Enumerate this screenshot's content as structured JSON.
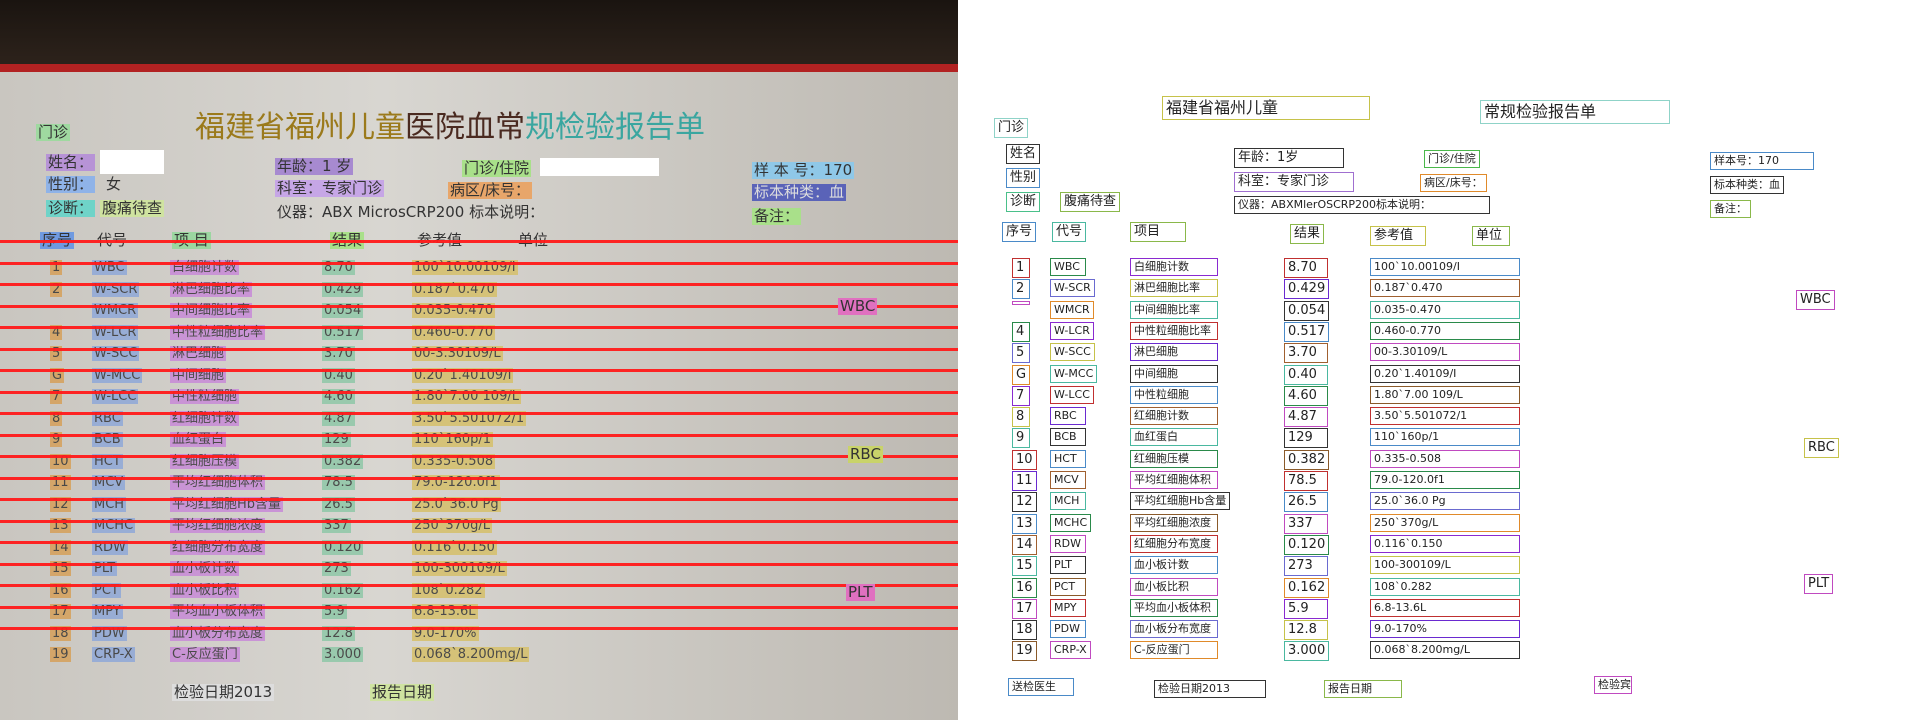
{
  "header": {
    "hospital": "福建省福州儿童",
    "report_title": "常规检验报告单",
    "ward_type": "门诊"
  },
  "patient": {
    "name_label": "姓名",
    "gender_label": "性别",
    "gender_value": "女",
    "diagnosis_label": "诊断",
    "diagnosis_value": "腹痛待查",
    "age": "年龄：1岁",
    "department": "科室：专家门诊",
    "instrument": "仪器：ABXMlerOSCRP200标本说明：",
    "outpatient": "门诊/住院",
    "ward_bed": "病区/床号：",
    "sample_no": "样本号：170",
    "sample_type": "标本种类：血",
    "remark": "备注："
  },
  "columns": {
    "seq": "序号",
    "code": "代号",
    "item": "项目",
    "result": "结果",
    "reference": "参考值",
    "unit": "单位"
  },
  "rows": [
    {
      "seq": "1",
      "code": "WBC",
      "item": "白细胞计数",
      "result": "8.70",
      "ref": "100`10.00109/I"
    },
    {
      "seq": "2",
      "code": "W-SCR",
      "item": "淋巴细胞比率",
      "result": "0.429",
      "ref": "0.187`0.470"
    },
    {
      "seq": "",
      "code": "WMCR",
      "item": "中间细胞比率",
      "result": "0.054",
      "ref": "0.035-0.470"
    },
    {
      "seq": "4",
      "code": "W-LCR",
      "item": "中性粒细胞比率",
      "result": "0.517",
      "ref": "0.460-0.770"
    },
    {
      "seq": "5",
      "code": "W-SCC",
      "item": "淋巴细胞",
      "result": "3.70",
      "ref": "00-3.30109/L"
    },
    {
      "seq": "G",
      "code": "W-MCC",
      "item": "中间细胞",
      "result": "0.40",
      "ref": "0.20`1.40109/I"
    },
    {
      "seq": "7",
      "code": "W-LCC",
      "item": "中性粒细胞",
      "result": "4.60",
      "ref": "1.80`7.00 109/L"
    },
    {
      "seq": "8",
      "code": "RBC",
      "item": "红细胞计数",
      "result": "4.87",
      "ref": "3.50`5.501072/1"
    },
    {
      "seq": "9",
      "code": "BCB",
      "item": "血红蛋白",
      "result": "129",
      "ref": "110`160p/1"
    },
    {
      "seq": "10",
      "code": "HCT",
      "item": "红细胞压模",
      "result": "0.382",
      "ref": "0.335-0.508"
    },
    {
      "seq": "11",
      "code": "MCV",
      "item": "平均红细胞体积",
      "result": "78.5",
      "ref": "79.0-120.0f1"
    },
    {
      "seq": "12",
      "code": "MCH",
      "item": "平均红细胞Hb含量",
      "result": "26.5",
      "ref": "25.0`36.0 Pg"
    },
    {
      "seq": "13",
      "code": "MCHC",
      "item": "平均红细胞浓度",
      "result": "337",
      "ref": "250`370g/L"
    },
    {
      "seq": "14",
      "code": "RDW",
      "item": "红细胞分布宽度",
      "result": "0.120",
      "ref": "0.116`0.150"
    },
    {
      "seq": "15",
      "code": "PLT",
      "item": "血小板计数",
      "result": "273",
      "ref": "100-300109/L"
    },
    {
      "seq": "16",
      "code": "PCT",
      "item": "血小板比积",
      "result": "0.162",
      "ref": "108`0.282"
    },
    {
      "seq": "17",
      "code": "MPY",
      "item": "平均血小板体积",
      "result": "5.9",
      "ref": "6.8-13.6L"
    },
    {
      "seq": "18",
      "code": "PDW",
      "item": "血小板分布宽度",
      "result": "12.8",
      "ref": "9.0-170%"
    },
    {
      "seq": "19",
      "code": "CRP-X",
      "item": "C-反应蛋门",
      "result": "3.000",
      "ref": "0.068`8.200mg/L"
    }
  ],
  "side_labels": {
    "wbc": "WBC",
    "rbc": "RBC",
    "plt": "PLT"
  },
  "footer": {
    "doctor": "送检医生",
    "test_date": "检验日期2013",
    "report_date": "报告日期",
    "checker": "检验宾"
  },
  "photo": {
    "title_part1": "福建省福州儿童",
    "title_part2": "医院血常",
    "title_part3": "规检验报告单",
    "ward_type": "门诊",
    "name_label": "姓名：",
    "gender_label": "性别：",
    "gender_value": "女",
    "diagnosis_label": "诊断：",
    "diagnosis_value": "腹痛待查",
    "age": "年龄：1 岁",
    "department": "科室：专家门诊",
    "instrument": "仪器：ABX MicrosCRP200 标本说明：",
    "outpatient": "门诊/住院",
    "ward_bed": "病区/床号：",
    "sample_no": "样 本 号：170",
    "sample_type": "标本种类：血",
    "remark": "备注：",
    "col_seq": "序号",
    "col_code": "代号",
    "col_item": "项 目",
    "col_result": "结果",
    "col_ref": "参考值",
    "col_unit": "单位",
    "wbc": "WBC",
    "rbc": "RBC",
    "plt": "PLT",
    "footer_test_date": "检验日期2013",
    "footer_report_date": "报告日期"
  }
}
